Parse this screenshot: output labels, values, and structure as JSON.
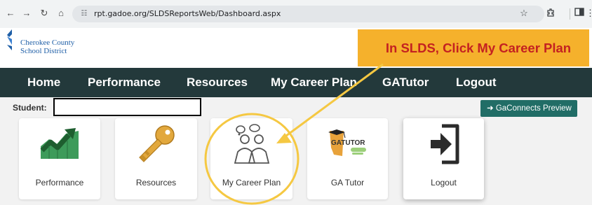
{
  "browser": {
    "url": "rpt.gadoe.org/SLDSReportsWeb/Dashboard.aspx",
    "back_icon": "arrow-left-icon",
    "forward_icon": "arrow-right-icon",
    "reload_icon": "reload-icon",
    "home_icon": "home-icon"
  },
  "header": {
    "logo_line1": "Cherokee County",
    "logo_line2": "School District",
    "callout": "In SLDS, Click My Career Plan"
  },
  "nav": {
    "items": [
      "Home",
      "Performance",
      "Resources",
      "My Career Plan",
      "GATutor",
      "Logout"
    ]
  },
  "student": {
    "label": "Student:",
    "value": ""
  },
  "preview_button": "GaConnects Preview",
  "cards": [
    {
      "label": "Performance",
      "icon": "growth-chart-icon"
    },
    {
      "label": "Resources",
      "icon": "key-icon"
    },
    {
      "label": "My Career Plan",
      "icon": "people-thought-icon"
    },
    {
      "label": "GA Tutor",
      "icon": "ga-tutor-logo-icon"
    },
    {
      "label": "Logout",
      "icon": "logout-icon"
    }
  ],
  "gatutor_logo": {
    "text": "GATUTOR"
  },
  "colors": {
    "navbar": "#23393b",
    "callout_bg": "#f5b12c",
    "callout_text": "#c42121",
    "annotation": "#f5c842",
    "preview_button": "#216d66",
    "chart_green": "#3d9b5a"
  }
}
